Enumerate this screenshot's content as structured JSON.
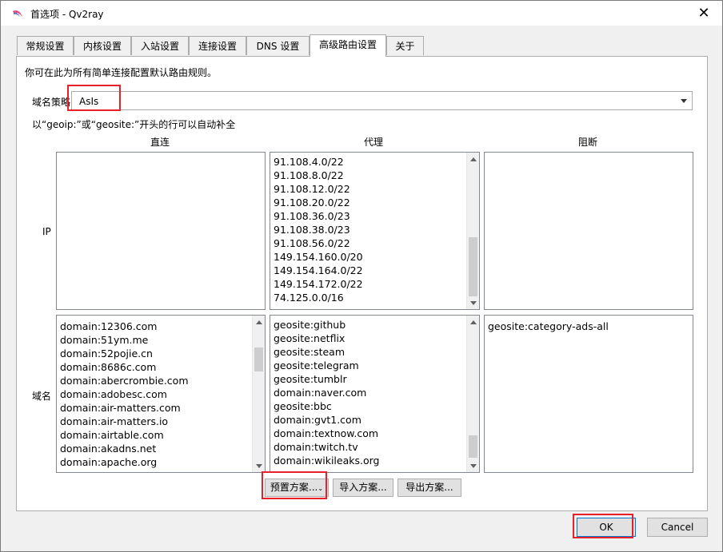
{
  "window": {
    "title": "首选项 - Qv2ray"
  },
  "tabs": [
    {
      "label": "常规设置"
    },
    {
      "label": "内核设置"
    },
    {
      "label": "入站设置"
    },
    {
      "label": "连接设置"
    },
    {
      "label": "DNS 设置"
    },
    {
      "label": "高级路由设置",
      "active": true
    },
    {
      "label": "关于"
    }
  ],
  "routing": {
    "description": "你可在此为所有简单连接配置默认路由规则。",
    "strategy_label": "域名策略",
    "strategy_value": "AsIs",
    "hint": "以“geoip:”或“geosite:”开头的行可以自动补全",
    "columns": {
      "direct": "直连",
      "proxy": "代理",
      "block": "阻断"
    },
    "row_ip": "IP",
    "row_domain": "域名",
    "ip_direct": [],
    "ip_proxy": [
      "91.108.4.0/22",
      "91.108.8.0/22",
      "91.108.12.0/22",
      "91.108.20.0/22",
      "91.108.36.0/23",
      "91.108.38.0/23",
      "91.108.56.0/22",
      "149.154.160.0/20",
      "149.154.164.0/22",
      "149.154.172.0/22",
      "74.125.0.0/16"
    ],
    "ip_block": [],
    "domain_direct": [
      "domain:12306.com",
      "domain:51ym.me",
      "domain:52pojie.cn",
      "domain:8686c.com",
      "domain:abercrombie.com",
      "domain:adobesc.com",
      "domain:air-matters.com",
      "domain:air-matters.io",
      "domain:airtable.com",
      "domain:akadns.net",
      "domain:apache.org"
    ],
    "domain_proxy": [
      "geosite:github",
      "geosite:netflix",
      "geosite:steam",
      "geosite:telegram",
      "geosite:tumblr",
      "domain:naver.com",
      "geosite:bbc",
      "domain:gvt1.com",
      "domain:textnow.com",
      "domain:twitch.tv",
      "domain:wikileaks.org"
    ],
    "domain_block": [
      "geosite:category-ads-all"
    ]
  },
  "buttons": {
    "preset": "预置方案...",
    "import": "导入方案...",
    "export": "导出方案...",
    "ok": "OK",
    "cancel": "Cancel"
  },
  "colors": {
    "highlight": "#e8202a",
    "accent": "#0078d7"
  }
}
